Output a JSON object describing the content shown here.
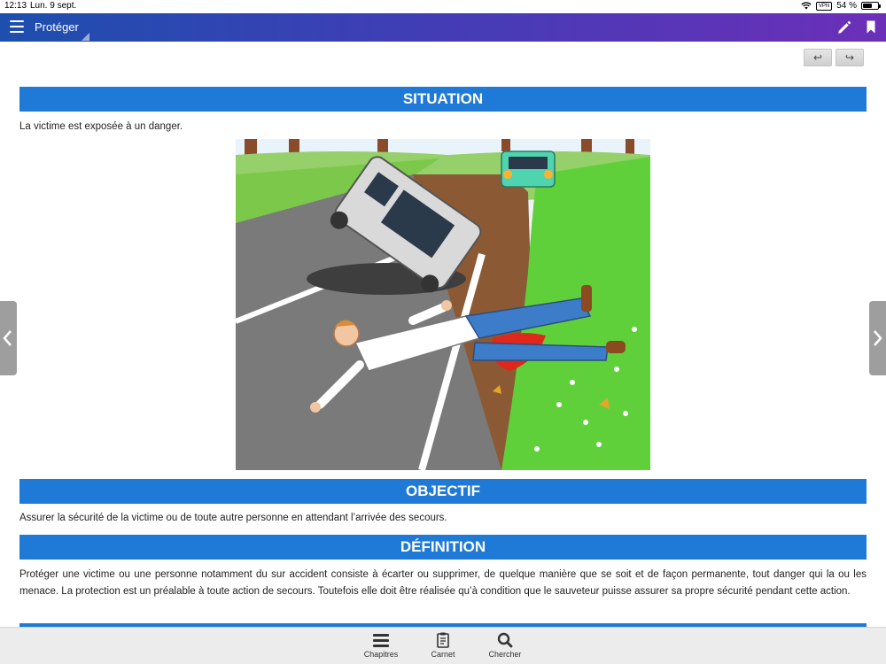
{
  "status_bar": {
    "time": "12:13",
    "date": "Lun. 9 sept.",
    "vpn": "VPN",
    "battery": "54 %",
    "battery_level": 0.54
  },
  "nav": {
    "title": "Protéger",
    "menu_icon": "hamburger-menu-icon",
    "pencil_icon": "pencil-icon",
    "bookmark_icon": "bookmark-icon"
  },
  "toolbar": {
    "undo_label": "↩",
    "redo_label": "↪"
  },
  "sections": {
    "situation": {
      "title": "SITUATION",
      "text": "La victime est exposée à un danger."
    },
    "objectif": {
      "title": "OBJECTIF",
      "text": "Assurer la sécurité de la victime ou de toute autre personne en attendant l’arrivée des secours."
    },
    "definition": {
      "title": "DÉFINITION",
      "text": "Protéger une victime ou une personne notamment du sur accident consiste à écarter ou supprimer, de quelque manière que se soit et de façon permanente, tout danger qui la ou les menace. La protection est un préalable à toute action de secours. Toutefois elle doit être réalisée qu’à condition que le sauveteur puisse assurer sa propre sécurité pendant cette action."
    }
  },
  "illustration": {
    "subject": "overturned car and injured victim lying on the road"
  },
  "tabbar": {
    "chapitres": "Chapitres",
    "carnet": "Carnet",
    "chercher": "Chercher"
  },
  "colors": {
    "accent": "#1f7ad7",
    "nav_start": "#1d4fae",
    "nav_end": "#6c2fb8"
  }
}
